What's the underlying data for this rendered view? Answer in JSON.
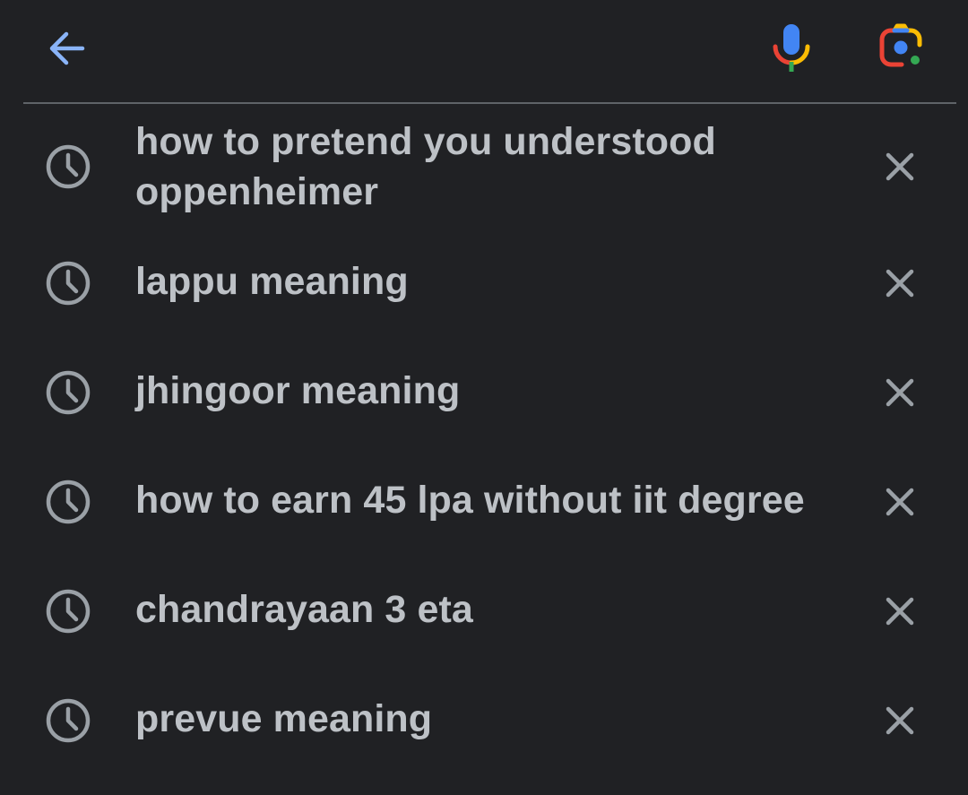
{
  "header": {
    "back_icon": "arrow-left-icon",
    "mic_icon": "microphone-icon",
    "lens_icon": "google-lens-icon"
  },
  "colors": {
    "background": "#202124",
    "text": "#bdc1c6",
    "icon_gray": "#9aa0a6",
    "accent_blue": "#8ab4f8",
    "google_blue": "#4285f4",
    "google_red": "#ea4335",
    "google_yellow": "#fbbc04",
    "google_green": "#34a853"
  },
  "history": [
    {
      "text": "how to pretend you understood oppenheimer",
      "icon": "history-clock-icon",
      "remove_icon": "close-icon"
    },
    {
      "text": "lappu meaning",
      "icon": "history-clock-icon",
      "remove_icon": "close-icon"
    },
    {
      "text": "jhingoor meaning",
      "icon": "history-clock-icon",
      "remove_icon": "close-icon"
    },
    {
      "text": "how to earn 45 lpa without iit degree",
      "icon": "history-clock-icon",
      "remove_icon": "close-icon"
    },
    {
      "text": "chandrayaan 3 eta",
      "icon": "history-clock-icon",
      "remove_icon": "close-icon"
    },
    {
      "text": "prevue meaning",
      "icon": "history-clock-icon",
      "remove_icon": "close-icon"
    }
  ]
}
